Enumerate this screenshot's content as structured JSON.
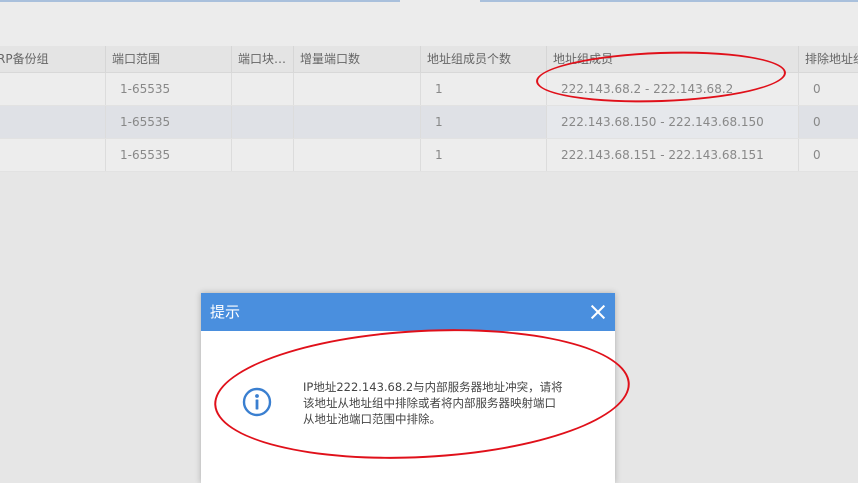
{
  "table": {
    "columns": [
      "RP备份组",
      "端口范围",
      "端口块…",
      "增量端口数",
      "地址组成员个数",
      "地址组成员",
      "排除地址组"
    ],
    "rows": [
      [
        "",
        "1-65535",
        "",
        "",
        "1",
        "222.143.68.2 - 222.143.68.2",
        "0"
      ],
      [
        "",
        "1-65535",
        "",
        "",
        "1",
        "222.143.68.150 - 222.143.68.150",
        "0"
      ],
      [
        "",
        "1-65535",
        "",
        "",
        "1",
        "222.143.68.151 - 222.143.68.151",
        "0"
      ]
    ]
  },
  "dialog": {
    "title": "提示",
    "message_lines": [
      "IP地址222.143.68.2与内部服务器地址冲突，请将",
      "该地址从地址组中排除或者将内部服务器映射端口",
      "从地址池端口范围中排除。"
    ],
    "close_icon": "close-icon",
    "info_icon": "info-icon"
  },
  "colors": {
    "dialog_header": "#4a8fde",
    "annotation": "#e0101a",
    "page_background": "#e6e6e6"
  }
}
